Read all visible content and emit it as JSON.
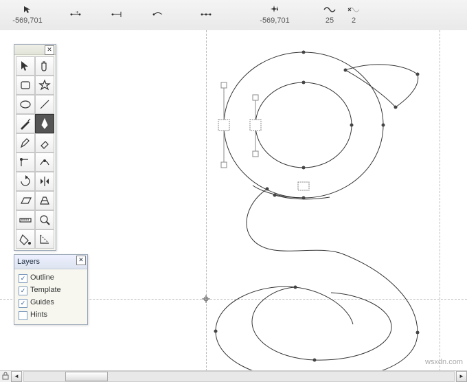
{
  "top_bar": {
    "items": [
      {
        "id": "coord-left",
        "value": "-569,701"
      },
      {
        "id": "spacer1",
        "value": ""
      },
      {
        "id": "spacer2",
        "value": ""
      },
      {
        "id": "spacer3",
        "value": ""
      },
      {
        "id": "spacer4",
        "value": ""
      },
      {
        "id": "coord-right",
        "value": "-569,701"
      },
      {
        "id": "segment",
        "value": "25"
      },
      {
        "id": "twist",
        "value": "2"
      }
    ]
  },
  "toolbox": {
    "close": "✕",
    "tools": [
      {
        "name": "pointer-tool"
      },
      {
        "name": "hand-tool"
      },
      {
        "name": "rect-tool"
      },
      {
        "name": "star-tool"
      },
      {
        "name": "ellipse-tool"
      },
      {
        "name": "line-tool"
      },
      {
        "name": "knife-tool"
      },
      {
        "name": "pen-tool",
        "active": true
      },
      {
        "name": "pencil-tool"
      },
      {
        "name": "eraser-tool"
      },
      {
        "name": "corner-tool"
      },
      {
        "name": "tangent-tool"
      },
      {
        "name": "rotate-tool"
      },
      {
        "name": "mirror-tool"
      },
      {
        "name": "skew-tool"
      },
      {
        "name": "perspective-tool"
      },
      {
        "name": "measure-tool"
      },
      {
        "name": "zoom-tool"
      },
      {
        "name": "fill-tool"
      },
      {
        "name": "guide-tool"
      }
    ]
  },
  "layers_panel": {
    "title": "Layers",
    "close": "✕",
    "rows": [
      {
        "label": "Outline",
        "checked": true
      },
      {
        "label": "Template",
        "checked": true
      },
      {
        "label": "Guides",
        "checked": true
      },
      {
        "label": "Hints",
        "checked": false
      }
    ]
  },
  "guides": {
    "v": [
      300,
      640
    ],
    "h": [
      391
    ]
  },
  "watermark": "wsxdn.com",
  "scrollbar": {
    "left_arrow": "◄",
    "right_arrow": "►"
  }
}
